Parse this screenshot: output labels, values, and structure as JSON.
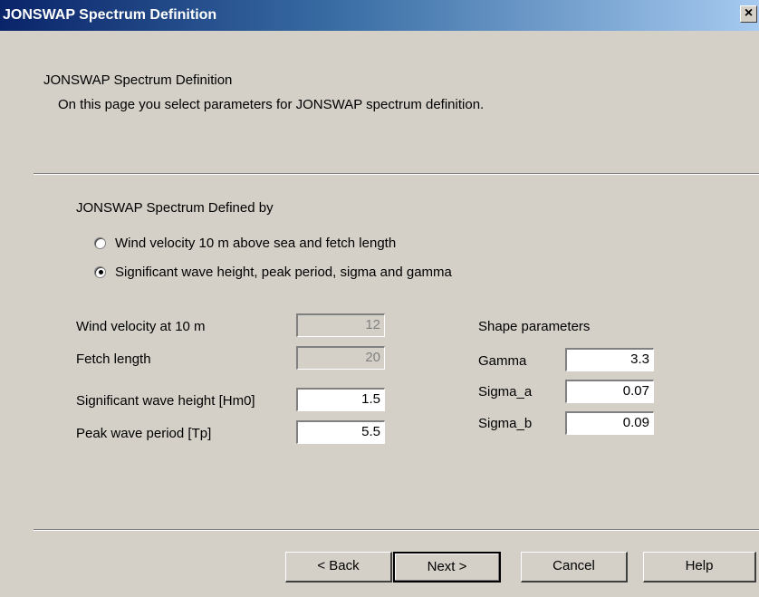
{
  "window": {
    "title": "JONSWAP Spectrum Definition",
    "close_glyph": "×"
  },
  "header": {
    "title": "JONSWAP Spectrum Definition",
    "description": "On this page you select parameters for JONSWAP spectrum definition."
  },
  "definition": {
    "group_label": "JONSWAP Spectrum Defined by",
    "options": [
      {
        "label": "Wind velocity 10 m above sea and fetch length",
        "selected": false
      },
      {
        "label": "Significant wave height, peak period, sigma and gamma",
        "selected": true
      }
    ]
  },
  "fields": {
    "wind_velocity": {
      "label": "Wind velocity at 10 m",
      "value": "12",
      "enabled": false
    },
    "fetch_length": {
      "label": "Fetch length",
      "value": "20",
      "enabled": false
    },
    "sig_wave_height": {
      "label": "Significant wave height [Hm0]",
      "value": "1.5",
      "enabled": true
    },
    "peak_period": {
      "label": "Peak wave period [Tp]",
      "value": "5.5",
      "enabled": true
    }
  },
  "shape": {
    "title": "Shape parameters",
    "gamma": {
      "label": "Gamma",
      "value": "3.3"
    },
    "sigma_a": {
      "label": "Sigma_a",
      "value": "0.07"
    },
    "sigma_b": {
      "label": "Sigma_b",
      "value": "0.09"
    }
  },
  "buttons": {
    "back": "< Back",
    "next": "Next >",
    "cancel": "Cancel",
    "help": "Help"
  }
}
